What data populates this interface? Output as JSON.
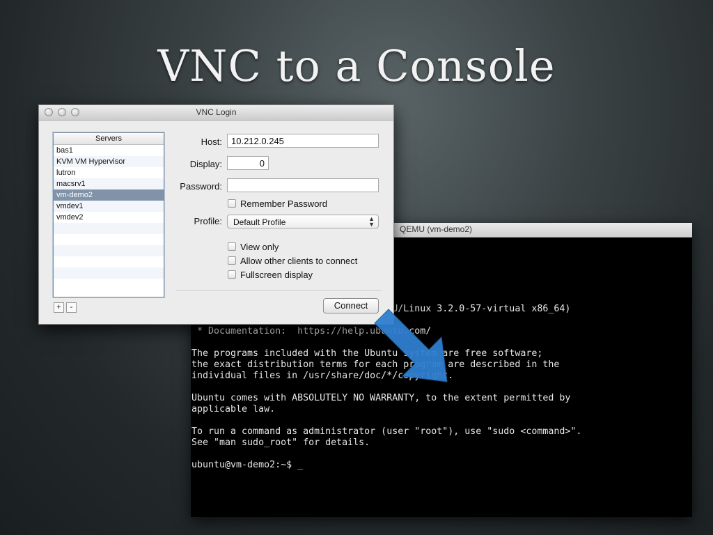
{
  "slide": {
    "title": "VNC to a Console"
  },
  "vnc_login": {
    "title": "VNC Login",
    "servers": {
      "header": "Servers",
      "items": [
        "bas1",
        "KVM VM Hypervisor",
        "lutron",
        "macsrv1",
        "vm-demo2",
        "vmdev1",
        "vmdev2"
      ],
      "selected": "vm-demo2",
      "add_label": "+",
      "remove_label": "-"
    },
    "host": {
      "label": "Host:",
      "value": "10.212.0.245"
    },
    "display": {
      "label": "Display:",
      "value": "0"
    },
    "password": {
      "label": "Password:",
      "value": ""
    },
    "remember_password": {
      "label": "Remember Password",
      "checked": false
    },
    "profile": {
      "label": "Profile:",
      "value": "Default Profile"
    },
    "view_only": {
      "label": "View only",
      "checked": false
    },
    "allow_other": {
      "label": "Allow other clients to connect",
      "checked": false
    },
    "fullscreen": {
      "label": "Fullscreen display",
      "checked": false
    },
    "connect_label": "Connect"
  },
  "qemu": {
    "title": "QEMU (vm-demo2)",
    "console_lines": [
      "                                   NU/Linux 3.2.0-57-virtual x86_64)",
      "",
      " * Documentation:  https://help.ubuntu.com/",
      "",
      "The programs included with the Ubuntu system are free software;",
      "the exact distribution terms for each program are described in the",
      "individual files in /usr/share/doc/*/copyright.",
      "",
      "Ubuntu comes with ABSOLUTELY NO WARRANTY, to the extent permitted by",
      "applicable law.",
      "",
      "To run a command as administrator (user \"root\"), use \"sudo <command>\".",
      "See \"man sudo_root\" for details.",
      "",
      "ubuntu@vm-demo2:~$ _"
    ]
  },
  "colors": {
    "selection": "#8193a8",
    "arrow": "#2f7fd0",
    "console_bg": "#000000",
    "console_fg": "#e6e6e6"
  }
}
